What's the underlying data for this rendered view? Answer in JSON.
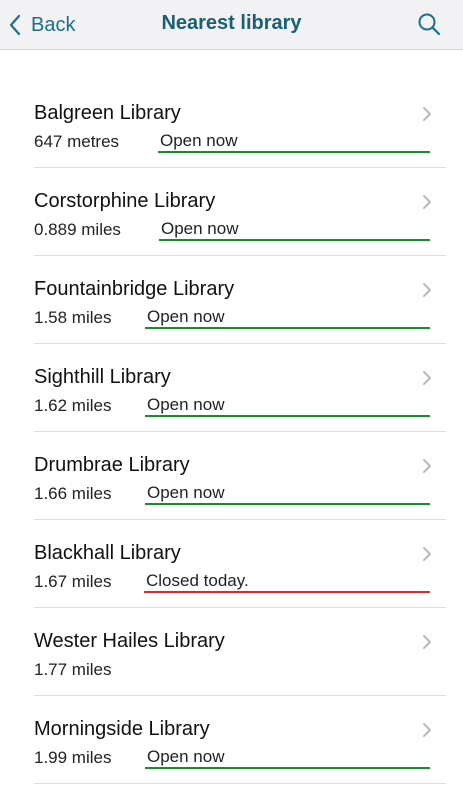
{
  "header": {
    "back_label": "Back",
    "title": "Nearest library"
  },
  "colors": {
    "accent": "#1a6f8a",
    "open_underline": "#1e8a2a",
    "closed_underline": "#e3262a"
  },
  "libraries": [
    {
      "name": "Balgreen Library",
      "distance": "647 metres",
      "status": "Open now",
      "open": true
    },
    {
      "name": "Corstorphine Library",
      "distance": "0.889 miles",
      "status": "Open now",
      "open": true
    },
    {
      "name": "Fountainbridge Library",
      "distance": "1.58 miles",
      "status": "Open now",
      "open": true
    },
    {
      "name": "Sighthill Library",
      "distance": "1.62 miles",
      "status": "Open now",
      "open": true
    },
    {
      "name": "Drumbrae Library",
      "distance": "1.66 miles",
      "status": "Open now",
      "open": true
    },
    {
      "name": "Blackhall Library",
      "distance": "1.67 miles",
      "status": "Closed today.",
      "open": false
    },
    {
      "name": "Wester Hailes Library",
      "distance": "1.77 miles",
      "status": "",
      "open": null
    },
    {
      "name": "Morningside Library",
      "distance": "1.99 miles",
      "status": "Open now",
      "open": true
    }
  ]
}
